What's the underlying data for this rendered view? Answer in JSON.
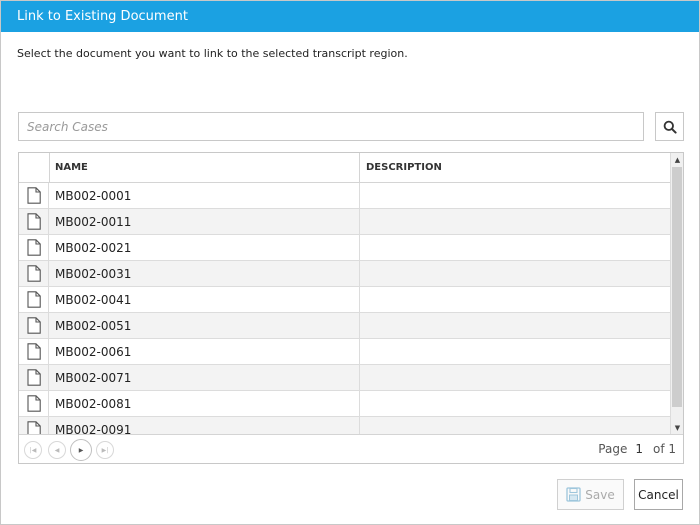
{
  "dialog": {
    "title": "Link to Existing Document",
    "instructions": "Select the document you want to link to the selected transcript region."
  },
  "search": {
    "placeholder": "Search Cases",
    "value": "",
    "icon": "search-icon"
  },
  "grid": {
    "columns": [
      "NAME",
      "DESCRIPTION"
    ],
    "row_icon": "document-icon",
    "rows": [
      {
        "name": "MB002-0001",
        "description": ""
      },
      {
        "name": "MB002-0011",
        "description": ""
      },
      {
        "name": "MB002-0021",
        "description": ""
      },
      {
        "name": "MB002-0031",
        "description": ""
      },
      {
        "name": "MB002-0041",
        "description": ""
      },
      {
        "name": "MB002-0051",
        "description": ""
      },
      {
        "name": "MB002-0061",
        "description": ""
      },
      {
        "name": "MB002-0071",
        "description": ""
      },
      {
        "name": "MB002-0081",
        "description": ""
      },
      {
        "name": "MB002-0091",
        "description": ""
      }
    ]
  },
  "pager": {
    "page_label": "Page",
    "page": "1",
    "of_label": "of 1"
  },
  "footer": {
    "save_label": "Save",
    "cancel_label": "Cancel"
  },
  "colors": {
    "title_bar": "#1ba1e2",
    "alt_row": "#f3f3f3"
  }
}
